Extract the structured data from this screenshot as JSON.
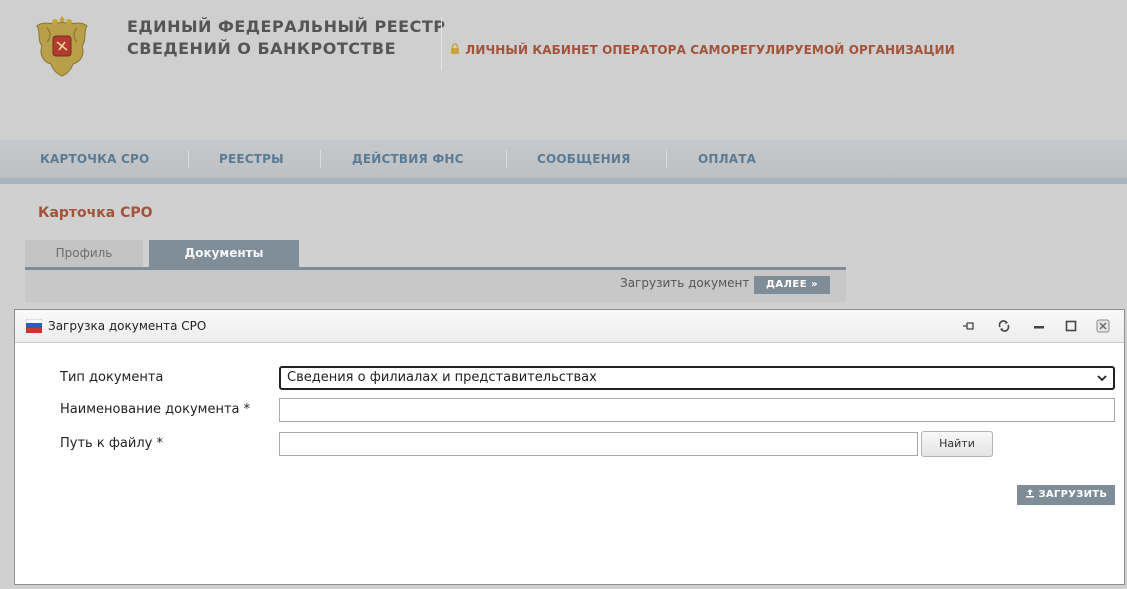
{
  "header": {
    "title_line1": "ЕДИНЫЙ ФЕДЕРАЛЬНЫЙ РЕЕСТР",
    "title_line2": "СВЕДЕНИЙ О БАНКРОТСТВЕ",
    "cabinet_label": "ЛИЧНЫЙ КАБИНЕТ ОПЕРАТОРА САМОРЕГУЛИРУЕМОЙ ОРГАНИЗАЦИИ",
    "logo_icon": "coat-of-arms-icon",
    "lock_icon": "lock-icon"
  },
  "nav": {
    "items": [
      {
        "label": "КАРТОЧКА СРО"
      },
      {
        "label": "РЕЕСТРЫ"
      },
      {
        "label": "ДЕЙСТВИЯ ФНС"
      },
      {
        "label": "СООБЩЕНИЯ"
      },
      {
        "label": "ОПЛАТА"
      }
    ]
  },
  "card": {
    "title": "Карточка СРО",
    "tabs": [
      {
        "label": "Профиль",
        "active": false
      },
      {
        "label": "Документы",
        "active": true
      }
    ],
    "upload_label": "Загрузить документ",
    "next_button": "ДАЛЕЕ »"
  },
  "dialog": {
    "title": "Загрузка документа СРО",
    "controls": [
      "pin-icon",
      "refresh-icon",
      "minimize-icon",
      "maximize-icon",
      "close-icon"
    ],
    "fields": {
      "doc_type_label": "Тип документа",
      "doc_type_value": "Сведения о филиалах и представительствах",
      "doc_name_label": "Наименование документа *",
      "doc_name_value": "",
      "file_path_label": "Путь к файлу *",
      "file_path_value": ""
    },
    "find_button": "Найти",
    "upload_button": "ЗАГРУЗИТЬ"
  },
  "colors": {
    "accent": "#a35339",
    "nav_text": "#5b7b94",
    "tab_active": "#7f8d99"
  }
}
